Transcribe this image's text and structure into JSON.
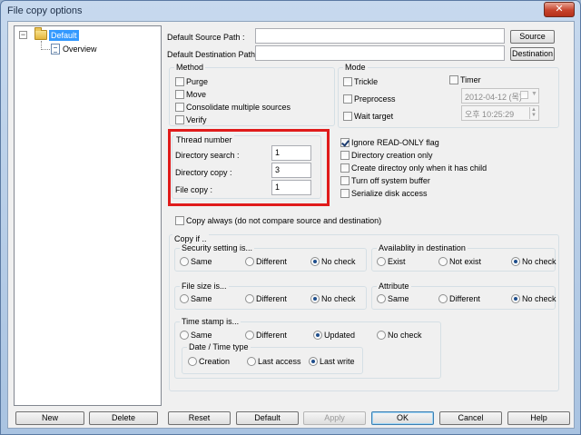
{
  "window": {
    "title": "File copy options",
    "close_glyph": "✕"
  },
  "tree": {
    "expander_glyph": "−",
    "root_label": "Default",
    "child_label": "Overview"
  },
  "paths": {
    "source_label": "Default Source Path :",
    "destination_label": "Default Destination Path :",
    "source_value": "",
    "destination_value": "",
    "source_button": "Source",
    "destination_button": "Destination"
  },
  "method": {
    "title": "Method",
    "options": [
      {
        "label": "Purge",
        "checked": false
      },
      {
        "label": "Move",
        "checked": false
      },
      {
        "label": "Consolidate multiple sources",
        "checked": false
      },
      {
        "label": "Verify",
        "checked": false
      }
    ]
  },
  "mode": {
    "title": "Mode",
    "trickle": "Trickle",
    "preprocess": "Preprocess",
    "wait_target": "Wait target",
    "timer": "Timer",
    "date_value": "2012-04-12 (목)",
    "time_value": "오후 10:25:29"
  },
  "thread": {
    "title": "Thread number",
    "directory_search_label": "Directory search :",
    "directory_copy_label": "Directory copy :",
    "file_copy_label": "File copy :",
    "directory_search_value": "1",
    "directory_copy_value": "3",
    "file_copy_value": "1"
  },
  "flags": [
    {
      "label": "Ignore READ-ONLY flag",
      "checked": true
    },
    {
      "label": "Directory creation only",
      "checked": false
    },
    {
      "label": "Create directoy only when it has child",
      "checked": false
    },
    {
      "label": "Turn off system buffer",
      "checked": false
    },
    {
      "label": "Serialize disk access",
      "checked": false
    }
  ],
  "copy_always": {
    "label": "Copy always (do not compare source and destination)",
    "checked": false
  },
  "copy_if": {
    "title": "Copy if ..",
    "security": {
      "title": "Security setting is...",
      "options": [
        "Same",
        "Different",
        "No check"
      ],
      "selected": 2
    },
    "availability": {
      "title": "Availablity in destination",
      "options": [
        "Exist",
        "Not exist",
        "No check"
      ],
      "selected": 2
    },
    "file_size": {
      "title": "File size is...",
      "options": [
        "Same",
        "Different",
        "No check"
      ],
      "selected": 2
    },
    "attribute": {
      "title": "Attribute",
      "options": [
        "Same",
        "Different",
        "No check"
      ],
      "selected": 2
    },
    "time_stamp": {
      "title": "Time stamp is...",
      "options": [
        "Same",
        "Different",
        "Updated",
        "No check"
      ],
      "selected": 2
    },
    "date_time_type": {
      "title": "Date / Time type",
      "options": [
        "Creation",
        "Last access",
        "Last write"
      ],
      "selected": 2
    }
  },
  "buttons": {
    "new": "New",
    "delete": "Delete",
    "reset": "Reset",
    "default": "Default",
    "apply": "Apply",
    "ok": "OK",
    "cancel": "Cancel",
    "help": "Help"
  },
  "colors": {
    "selection": "#3399ff",
    "highlight_box": "#e01b1b"
  }
}
